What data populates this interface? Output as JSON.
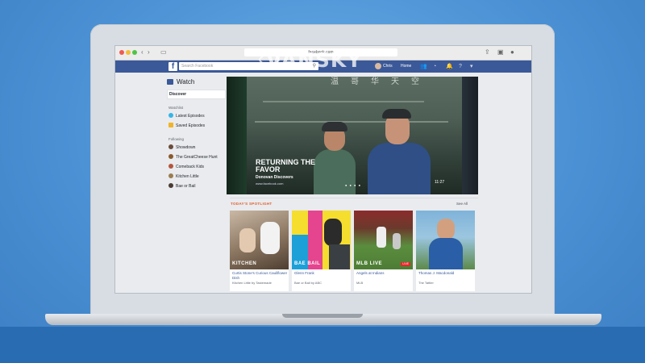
{
  "browser": {
    "url": "facebook.com"
  },
  "facebook": {
    "search_placeholder": "Search Facebook",
    "user_name": "Chris",
    "home_label": "Home"
  },
  "watermark": {
    "brand": "VANSKY",
    "sub": "温哥华天空"
  },
  "sidebar": {
    "title": "Watch",
    "discover": "Discover",
    "watchlist_heading": "Watchlist",
    "watchlist": [
      {
        "label": "Latest Episodes",
        "icon": "play-icon",
        "color": "#34b5e5"
      },
      {
        "label": "Saved Episodes",
        "icon": "bookmark-icon",
        "color": "#f0b429",
        "count": "2"
      }
    ],
    "following_heading": "Following",
    "following": [
      {
        "label": "Showdown",
        "color": "#6b4c3b"
      },
      {
        "label": "The GreatCheese Hunt",
        "color": "#8a5a2b"
      },
      {
        "label": "Comeback Kids",
        "color": "#b3563c"
      },
      {
        "label": "Kitchen Little",
        "color": "#9c7d4f"
      },
      {
        "label": "Bae or Bail",
        "color": "#4a3b32"
      }
    ]
  },
  "hero": {
    "title": "RETURNING THE FAVOR",
    "subtitle": "Donovan Discovers",
    "link": "www.facebook.com",
    "duration": "11:27"
  },
  "spotlight": {
    "heading": "TODAY'S SPOTLIGHT",
    "see_all": "See All",
    "cards": [
      {
        "title": "Curtis Stone's Curious Cauliflower Dish",
        "subtitle": "Kitchen Little by Tastemade",
        "thumb_label": "KITCHEN"
      },
      {
        "title": "Glenn Frank",
        "subtitle": "Bae or Bail by ABC",
        "thumb_label": "BAE BAIL"
      },
      {
        "title": "Angels at Indians",
        "subtitle": "MLB",
        "thumb_label": "MLB LIVE",
        "live": "LIVE"
      },
      {
        "title": "Thomas J. Macdonald",
        "subtitle": "The Tattler",
        "thumb_label": ""
      }
    ]
  }
}
